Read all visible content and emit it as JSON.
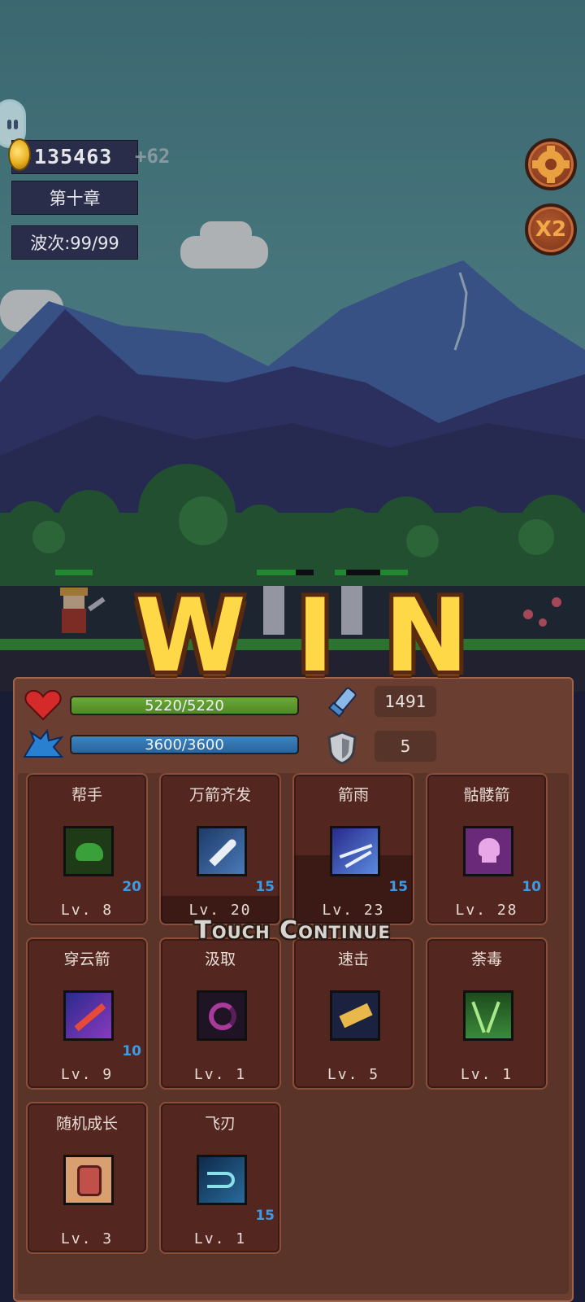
{
  "hud": {
    "coins": "135463",
    "coin_gain": "+62",
    "chapter": "第十章",
    "wave": "波次:99/99",
    "speed_label": "X2"
  },
  "battle": {
    "result": "WIN",
    "continue_prompt": "Touch Continue"
  },
  "stats": {
    "hp": "5220/5220",
    "hp_fill": 1.0,
    "mp": "3600/3600",
    "mp_fill": 1.0,
    "attack": "1491",
    "defense": "5"
  },
  "skills": [
    {
      "name": "帮手",
      "level": "Lv. 8",
      "count": "20",
      "icon": "green-slime-icon",
      "color": "#2a6a20"
    },
    {
      "name": "万箭齐发",
      "level": "Lv. 20",
      "count": "15",
      "icon": "arrow-volley-icon",
      "color": "#3a66a0"
    },
    {
      "name": "箭雨",
      "level": "Lv. 23",
      "count": "15",
      "icon": "arrow-rain-icon",
      "color": "#4058b8"
    },
    {
      "name": "骷髅箭",
      "level": "Lv. 28",
      "count": "10",
      "icon": "skull-arrow-icon",
      "color": "#8a3c9a"
    },
    {
      "name": "穿云箭",
      "level": "Lv. 9",
      "count": "10",
      "icon": "piercing-arrow-icon",
      "color": "#5a2ea0"
    },
    {
      "name": "汲取",
      "level": "Lv. 1",
      "count": "",
      "icon": "drain-spiral-icon",
      "color": "#5a2a6a"
    },
    {
      "name": "速击",
      "level": "Lv. 5",
      "count": "",
      "icon": "quick-strike-icon",
      "color": "#2a3a6a"
    },
    {
      "name": "荼毒",
      "level": "Lv. 1",
      "count": "",
      "icon": "poison-icon",
      "color": "#2e6a2a"
    },
    {
      "name": "随机成长",
      "level": "Lv. 3",
      "count": "",
      "icon": "fist-icon",
      "color": "#9a5a3a"
    },
    {
      "name": "飞刃",
      "level": "Lv. 1",
      "count": "15",
      "icon": "flying-blade-icon",
      "color": "#1e4a7a"
    }
  ]
}
